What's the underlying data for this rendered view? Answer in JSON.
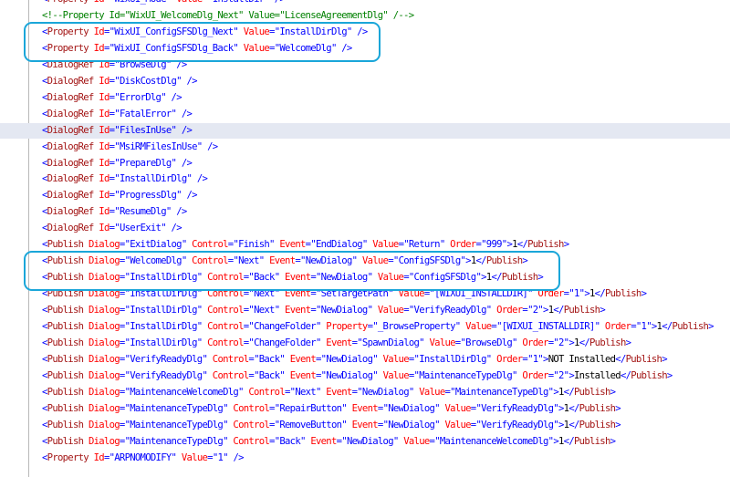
{
  "editor": {
    "lines": [
      {
        "kind": "el",
        "el": "Property",
        "attrs": [
          [
            "Id",
            "WixUI_Mode"
          ],
          [
            "Value",
            "InstallDir"
          ]
        ],
        "tail": ""
      },
      {
        "kind": "comment",
        "text": "<!--Property Id=\"WixUI_WelcomeDlg_Next\" Value=\"LicenseAgreementDlg\" /-->"
      },
      {
        "kind": "el",
        "el": "Property",
        "attrs": [
          [
            "Id",
            "WixUI_ConfigSFSDlg_Next"
          ],
          [
            "Value",
            "InstallDirDlg"
          ]
        ],
        "tail": ""
      },
      {
        "kind": "el",
        "el": "Property",
        "attrs": [
          [
            "Id",
            "WixUI_ConfigSFSDlg_Back"
          ],
          [
            "Value",
            "WelcomeDlg"
          ]
        ],
        "tail": ""
      },
      {
        "kind": "el",
        "el": "DialogRef",
        "attrs": [
          [
            "Id",
            "BrowseDlg"
          ]
        ],
        "tail": ""
      },
      {
        "kind": "el",
        "el": "DialogRef",
        "attrs": [
          [
            "Id",
            "DiskCostDlg"
          ]
        ],
        "tail": ""
      },
      {
        "kind": "el",
        "el": "DialogRef",
        "attrs": [
          [
            "Id",
            "ErrorDlg"
          ]
        ],
        "tail": ""
      },
      {
        "kind": "el",
        "el": "DialogRef",
        "attrs": [
          [
            "Id",
            "FatalError"
          ]
        ],
        "tail": ""
      },
      {
        "kind": "el",
        "el": "DialogRef",
        "attrs": [
          [
            "Id",
            "FilesInUse"
          ]
        ],
        "tail": "",
        "selected": true
      },
      {
        "kind": "el",
        "el": "DialogRef",
        "attrs": [
          [
            "Id",
            "MsiRMFilesInUse"
          ]
        ],
        "tail": ""
      },
      {
        "kind": "el",
        "el": "DialogRef",
        "attrs": [
          [
            "Id",
            "PrepareDlg"
          ]
        ],
        "tail": ""
      },
      {
        "kind": "el",
        "el": "DialogRef",
        "attrs": [
          [
            "Id",
            "InstallDirDlg"
          ]
        ],
        "tail": ""
      },
      {
        "kind": "el",
        "el": "DialogRef",
        "attrs": [
          [
            "Id",
            "ProgressDlg"
          ]
        ],
        "tail": ""
      },
      {
        "kind": "el",
        "el": "DialogRef",
        "attrs": [
          [
            "Id",
            "ResumeDlg"
          ]
        ],
        "tail": ""
      },
      {
        "kind": "el",
        "el": "DialogRef",
        "attrs": [
          [
            "Id",
            "UserExit"
          ]
        ],
        "tail": ""
      },
      {
        "kind": "pub",
        "attrs": [
          [
            "Dialog",
            "ExitDialog"
          ],
          [
            "Control",
            "Finish"
          ],
          [
            "Event",
            "EndDialog"
          ],
          [
            "Value",
            "Return"
          ],
          [
            "Order",
            "999"
          ]
        ],
        "text": "1"
      },
      {
        "kind": "pub",
        "attrs": [
          [
            "Dialog",
            "WelcomeDlg"
          ],
          [
            "Control",
            "Next"
          ],
          [
            "Event",
            "NewDialog"
          ],
          [
            "Value",
            "ConfigSFSDlg"
          ]
        ],
        "text": "1"
      },
      {
        "kind": "pub",
        "attrs": [
          [
            "Dialog",
            "InstallDirDlg"
          ],
          [
            "Control",
            "Back"
          ],
          [
            "Event",
            "NewDialog"
          ],
          [
            "Value",
            "ConfigSFSDlg"
          ]
        ],
        "text": "1"
      },
      {
        "kind": "pub",
        "attrs": [
          [
            "Dialog",
            "InstallDirDlg"
          ],
          [
            "Control",
            "Next"
          ],
          [
            "Event",
            "SetTargetPath"
          ],
          [
            "Value",
            "[WIXUI_INSTALLDIR]"
          ],
          [
            "Order",
            "1"
          ]
        ],
        "text": "1"
      },
      {
        "kind": "pub",
        "attrs": [
          [
            "Dialog",
            "InstallDirDlg"
          ],
          [
            "Control",
            "Next"
          ],
          [
            "Event",
            "NewDialog"
          ],
          [
            "Value",
            "VerifyReadyDlg"
          ],
          [
            "Order",
            "2"
          ]
        ],
        "text": "1"
      },
      {
        "kind": "pub",
        "attrs": [
          [
            "Dialog",
            "InstallDirDlg"
          ],
          [
            "Control",
            "ChangeFolder"
          ],
          [
            "Property",
            "_BrowseProperty"
          ],
          [
            "Value",
            "[WIXUI_INSTALLDIR]"
          ],
          [
            "Order",
            "1"
          ]
        ],
        "text": "1"
      },
      {
        "kind": "pub",
        "attrs": [
          [
            "Dialog",
            "InstallDirDlg"
          ],
          [
            "Control",
            "ChangeFolder"
          ],
          [
            "Event",
            "SpawnDialog"
          ],
          [
            "Value",
            "BrowseDlg"
          ],
          [
            "Order",
            "2"
          ]
        ],
        "text": "1"
      },
      {
        "kind": "pub",
        "attrs": [
          [
            "Dialog",
            "VerifyReadyDlg"
          ],
          [
            "Control",
            "Back"
          ],
          [
            "Event",
            "NewDialog"
          ],
          [
            "Value",
            "InstallDirDlg"
          ],
          [
            "Order",
            "1"
          ]
        ],
        "text": "NOT Installed"
      },
      {
        "kind": "pub",
        "attrs": [
          [
            "Dialog",
            "VerifyReadyDlg"
          ],
          [
            "Control",
            "Back"
          ],
          [
            "Event",
            "NewDialog"
          ],
          [
            "Value",
            "MaintenanceTypeDlg"
          ],
          [
            "Order",
            "2"
          ]
        ],
        "text": "Installed"
      },
      {
        "kind": "pub",
        "attrs": [
          [
            "Dialog",
            "MaintenanceWelcomeDlg"
          ],
          [
            "Control",
            "Next"
          ],
          [
            "Event",
            "NewDialog"
          ],
          [
            "Value",
            "MaintenanceTypeDlg"
          ]
        ],
        "text": "1"
      },
      {
        "kind": "pub",
        "attrs": [
          [
            "Dialog",
            "MaintenanceTypeDlg"
          ],
          [
            "Control",
            "RepairButton"
          ],
          [
            "Event",
            "NewDialog"
          ],
          [
            "Value",
            "VerifyReadyDlg"
          ]
        ],
        "text": "1"
      },
      {
        "kind": "pub",
        "attrs": [
          [
            "Dialog",
            "MaintenanceTypeDlg"
          ],
          [
            "Control",
            "RemoveButton"
          ],
          [
            "Event",
            "NewDialog"
          ],
          [
            "Value",
            "VerifyReadyDlg"
          ]
        ],
        "text": "1"
      },
      {
        "kind": "pub",
        "attrs": [
          [
            "Dialog",
            "MaintenanceTypeDlg"
          ],
          [
            "Control",
            "Back"
          ],
          [
            "Event",
            "NewDialog"
          ],
          [
            "Value",
            "MaintenanceWelcomeDlg"
          ]
        ],
        "text": "1"
      },
      {
        "kind": "el",
        "el": "Property",
        "attrs": [
          [
            "Id",
            "ARPNOMODIFY"
          ],
          [
            "Value",
            "1"
          ]
        ],
        "tail": ""
      }
    ]
  },
  "annotations": {
    "highlight_color": "#1aa6d9",
    "boxes": [
      {
        "label": "",
        "from_line": 2,
        "to_line": 3
      },
      {
        "label": "",
        "from_line": 16,
        "to_line": 17
      }
    ]
  },
  "colors": {
    "bracket": "#0000ff",
    "element": "#a31515",
    "attribute": "#ff0000",
    "value": "#0000ff",
    "comment": "#008000",
    "selected_line": "#e4e8f2"
  }
}
